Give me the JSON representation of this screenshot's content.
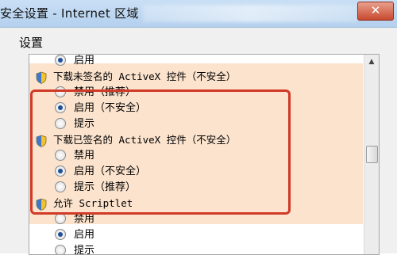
{
  "window": {
    "title": "安全设置 - Internet 区域",
    "close_glyph": "✕"
  },
  "settings": {
    "label": "设置",
    "rows": [
      {
        "kind": "option",
        "label": "启用",
        "checked": true
      },
      {
        "kind": "header",
        "label": "下载未签名的 ActiveX 控件（不安全）"
      },
      {
        "kind": "option",
        "label": "禁用（推荐）",
        "checked": false
      },
      {
        "kind": "option",
        "label": "启用（不安全）",
        "checked": true
      },
      {
        "kind": "option",
        "label": "提示",
        "checked": false
      },
      {
        "kind": "header",
        "label": "下载已签名的 ActiveX 控件（不安全）"
      },
      {
        "kind": "option",
        "label": "禁用",
        "checked": false
      },
      {
        "kind": "option",
        "label": "启用（不安全）",
        "checked": true
      },
      {
        "kind": "option",
        "label": "提示（推荐）",
        "checked": false
      },
      {
        "kind": "header",
        "label": "允许 Scriptlet"
      },
      {
        "kind": "option",
        "label": "禁用",
        "checked": false
      },
      {
        "kind": "option",
        "label": "启用",
        "checked": true
      },
      {
        "kind": "option",
        "label": "提示",
        "checked": false
      }
    ]
  },
  "scrollbar": {
    "up_glyph": "▲"
  },
  "colors": {
    "highlight": "#fbe3cd",
    "annotation": "#d03a27",
    "titlebar": "#c9dff5"
  },
  "icons": {
    "header_icon": "shield-icon"
  }
}
